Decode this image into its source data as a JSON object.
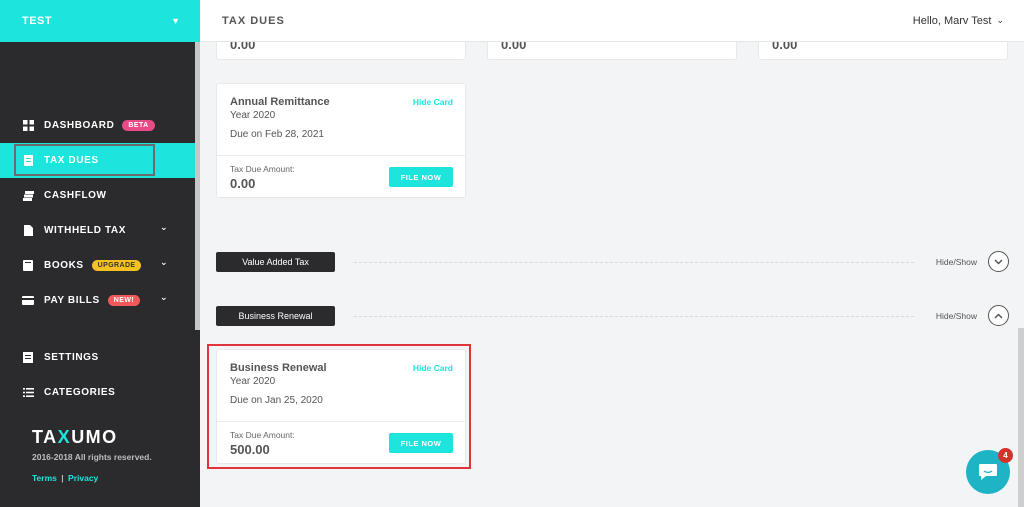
{
  "sidebar": {
    "org": "TEST",
    "nav": [
      {
        "label": "DASHBOARD",
        "badge": "BETA"
      },
      {
        "label": "TAX DUES"
      },
      {
        "label": "CASHFLOW"
      },
      {
        "label": "WITHHELD TAX"
      },
      {
        "label": "BOOKS",
        "badge": "UPGRADE"
      },
      {
        "label": "PAY BILLS",
        "badge": "NEW!"
      }
    ],
    "nav2": [
      {
        "label": "SETTINGS"
      },
      {
        "label": "CATEGORIES"
      }
    ],
    "brand_left": "TA",
    "brand_x": "X",
    "brand_right": "UMO",
    "copyright": "2016-2018 All rights reserved.",
    "terms": "Terms",
    "separator": "|",
    "privacy": "Privacy"
  },
  "header": {
    "title": "TAX DUES",
    "greeting": "Hello, Marv Test"
  },
  "top_cards": [
    {
      "amount": "0.00"
    },
    {
      "amount": "0.00"
    },
    {
      "amount": "0.00"
    }
  ],
  "annual_card": {
    "title": "Annual Remittance",
    "year": "Year 2020",
    "due": "Due on Feb 28, 2021",
    "hide": "Hide Card",
    "amount_label": "Tax Due Amount:",
    "amount": "0.00",
    "button": "FILE NOW"
  },
  "sections": [
    {
      "label": "Value Added Tax",
      "toggle": "Hide/Show"
    },
    {
      "label": "Business Renewal",
      "toggle": "Hide/Show"
    }
  ],
  "renewal_card": {
    "title": "Business Renewal",
    "year": "Year 2020",
    "due": "Due on Jan 25, 2020",
    "hide": "Hide Card",
    "amount_label": "Tax Due Amount:",
    "amount": "500.00",
    "button": "FILE NOW"
  },
  "chat": {
    "unread": "4"
  },
  "colors": {
    "accent": "#1de4dc",
    "sidebar": "#2b2b2e",
    "highlight": "#e0343a"
  }
}
